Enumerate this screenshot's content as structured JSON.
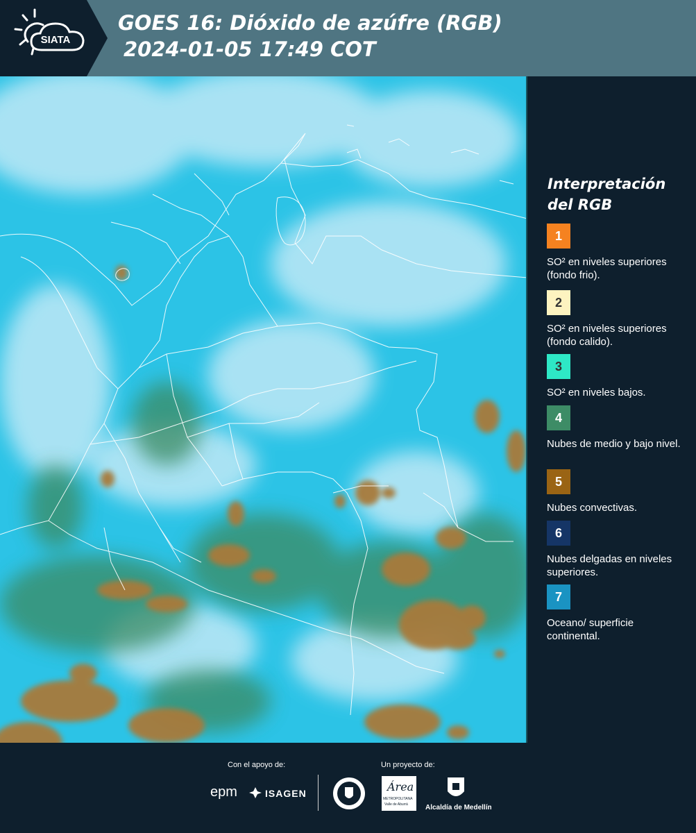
{
  "header": {
    "logo_text": "SIATA",
    "title_line1": "GOES 16: Dióxido de azúfre (RGB)",
    "title_line2": "2024-01-05 17:49 COT"
  },
  "legend": {
    "title": "Interpretación del RGB",
    "items": [
      {
        "number": "1",
        "color": "#f58220",
        "label": "SO² en niveles superiores (fondo frio)."
      },
      {
        "number": "2",
        "color": "#fdf3c0",
        "label": "SO² en niveles superiores (fondo calido)."
      },
      {
        "number": "3",
        "color": "#2ee8c6",
        "label": "SO² en niveles bajos."
      },
      {
        "number": "4",
        "color": "#3d8c66",
        "label": "Nubes de medio y bajo nivel."
      },
      {
        "number": "5",
        "color": "#9a6414",
        "label": "Nubes convectivas."
      },
      {
        "number": "6",
        "color": "#153566",
        "label": "Nubes delgadas en niveles superiores."
      },
      {
        "number": "7",
        "color": "#1a93c2",
        "label": "Oceano/ superficie continental."
      }
    ]
  },
  "map": {
    "colors": {
      "background": "#2cc3e6",
      "bright": "#bfe8f6",
      "convective": "#a87a3a",
      "mid_cloud": "#3a8a62",
      "borders": "#ffffff"
    }
  },
  "footer": {
    "support_label": "Con el apoyo de:",
    "project_label": "Un proyecto de:",
    "sponsor_epm": "epm",
    "sponsor_isagen": "ISAGEN",
    "area_metro": "Área",
    "area_metro_sub": "METROPOLITANA",
    "area_metro_sub2": "Valle de Aburrá",
    "alcaldia": "Alcaldía de Medellín"
  }
}
